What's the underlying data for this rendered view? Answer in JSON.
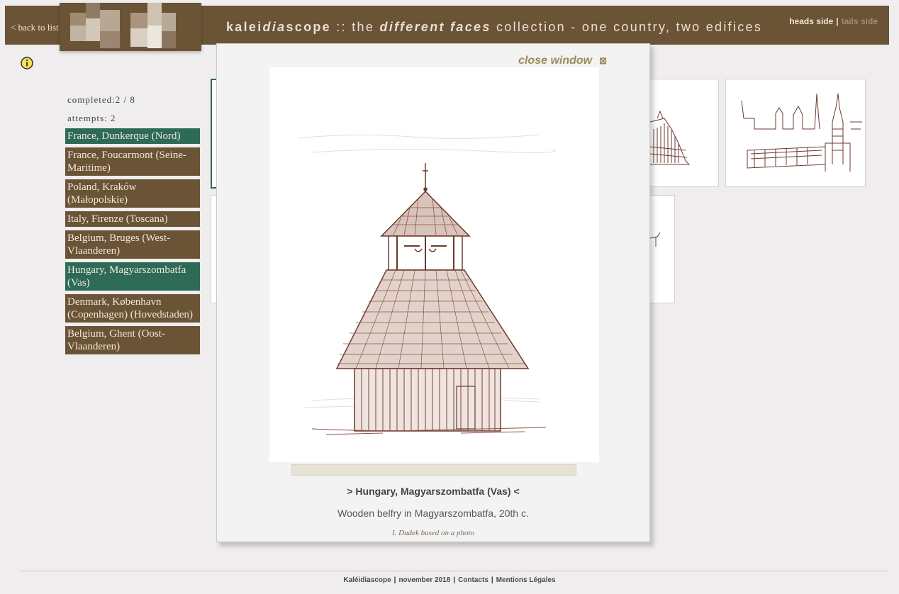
{
  "header": {
    "back_link": "< back to list",
    "title_part1": "kalei",
    "title_part2": "dia",
    "title_part3": "scope",
    "title_part4": " :: the ",
    "title_part5": "different faces",
    "title_part6": " collection - one country, two edifices",
    "heads_side": "heads side",
    "separator": "|",
    "tails_side": "tails side"
  },
  "stats": {
    "completed": "completed:2 / 8",
    "attempts": "attempts: 2"
  },
  "locations": [
    {
      "label": "France, Dunkerque (Nord)",
      "status": "done"
    },
    {
      "label": "France, Foucarmont (Seine-Maritime)",
      "status": "pending"
    },
    {
      "label": "Poland, Kraków (Małopolskie)",
      "status": "pending"
    },
    {
      "label": "Italy, Firenze (Toscana)",
      "status": "pending"
    },
    {
      "label": "Belgium, Bruges (West-Vlaanderen)",
      "status": "pending"
    },
    {
      "label": "Hungary, Magyarszombatfa (Vas)",
      "status": "done"
    },
    {
      "label": "Denmark, København (Copenhagen) (Hovedstaden)",
      "status": "pending"
    },
    {
      "label": "Belgium, Ghent (Oost-Vlaanderen)",
      "status": "pending"
    }
  ],
  "modal": {
    "close_label": "close window",
    "close_symbol": "⊠",
    "title": "> Hungary, Magyarszombatfa (Vas) <",
    "description": "Wooden belfry in Magyarszombatfa, 20th c.",
    "credit": "I. Dudek based on a photo"
  },
  "footer": {
    "site": "Kaléidiascope",
    "date": "november 2018",
    "contacts": "Contacts",
    "legal": "Mentions Légales",
    "sep": "|"
  },
  "colors": {
    "brand_brown": "#6b5336",
    "done_green": "#2d6a58",
    "sketch_ink": "#6b3a2e"
  }
}
